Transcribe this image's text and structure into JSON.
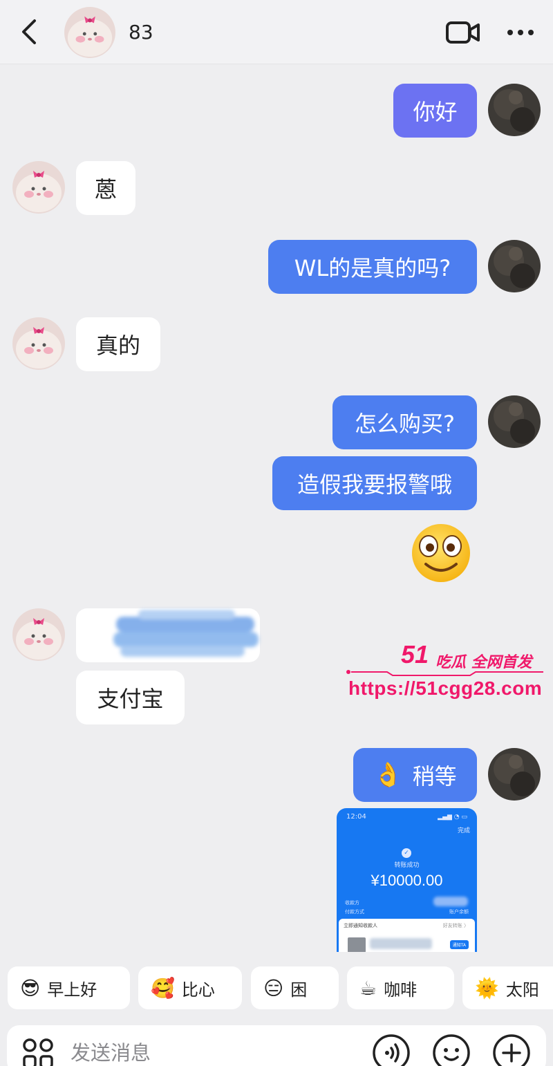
{
  "header": {
    "contact_name": "83",
    "contact_avatar": "bunny-avatar-icon"
  },
  "messages": {
    "m1": "你好",
    "m2": "蒽",
    "m3": "WL的是真的吗?",
    "m4": "真的",
    "m5": "怎么购买?",
    "m6": "造假我要报警哦",
    "m7_emoji": "smiley-face-icon",
    "m9": "支付宝",
    "m10": "稍等",
    "m10_emoji": "👌"
  },
  "payment_screenshot": {
    "time": "12:04",
    "done": "完成",
    "status": "转账成功",
    "amount": "¥10000.00",
    "payee": "收款方",
    "method": "付款方式",
    "method_value": "账户余额",
    "notice": "立即通知收款人",
    "notice_right": "好友转账 〉",
    "button": "通知TA"
  },
  "watermark": {
    "logo": "51",
    "tagline": "吃瓜 全网首发",
    "url": "https://51cgg28.com"
  },
  "quick_replies": [
    {
      "emoji": "😎",
      "label": "早上好"
    },
    {
      "emoji": "🥰",
      "label": "比心"
    },
    {
      "emoji": "😑",
      "label": "困"
    },
    {
      "emoji": "☕",
      "label": "咖啡"
    },
    {
      "emoji": "🌞",
      "label": "太阳"
    }
  ],
  "input": {
    "placeholder": "发送消息"
  },
  "colors": {
    "outgoing_bubble": "#4d7ef0",
    "first_outgoing_bubble": "#6c72f2",
    "incoming_bubble": "#ffffff",
    "background": "#eeeef0",
    "watermark": "#f0186a"
  }
}
